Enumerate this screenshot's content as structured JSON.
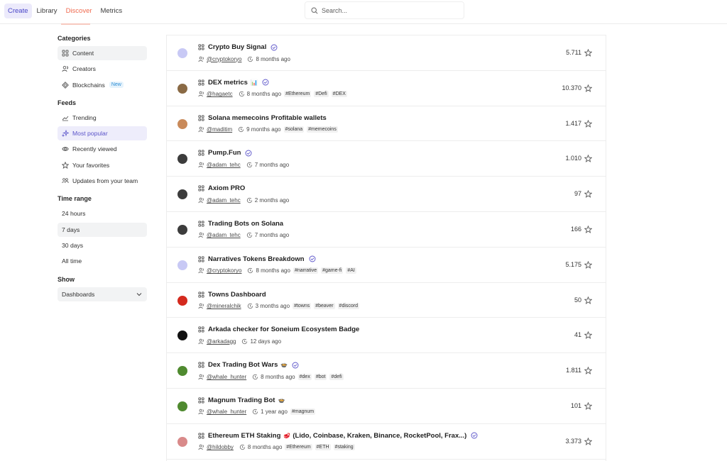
{
  "nav": {
    "tabs": [
      {
        "label": "Create"
      },
      {
        "label": "Library"
      },
      {
        "label": "Discover"
      },
      {
        "label": "Metrics"
      }
    ]
  },
  "search": {
    "placeholder": "Search..."
  },
  "sidebar": {
    "categories": {
      "heading": "Categories",
      "items": [
        {
          "label": "Content",
          "icon": "grid-icon"
        },
        {
          "label": "Creators",
          "icon": "users-icon"
        },
        {
          "label": "Blockchains",
          "icon": "diamond-icon",
          "badge": "New"
        }
      ]
    },
    "feeds": {
      "heading": "Feeds",
      "items": [
        {
          "label": "Trending",
          "icon": "trend-icon"
        },
        {
          "label": "Most popular",
          "icon": "sparkle-icon"
        },
        {
          "label": "Recently viewed",
          "icon": "eye-icon"
        },
        {
          "label": "Your favorites",
          "icon": "star-icon"
        },
        {
          "label": "Updates from your team",
          "icon": "team-icon"
        }
      ]
    },
    "time_range": {
      "heading": "Time range",
      "items": [
        {
          "label": "24 hours"
        },
        {
          "label": "7 days"
        },
        {
          "label": "30 days"
        },
        {
          "label": "All time"
        }
      ]
    },
    "show": {
      "heading": "Show",
      "selected": "Dashboards"
    }
  },
  "dashboards": [
    {
      "title": "Crypto Buy Signal",
      "emoji": "",
      "verified": true,
      "handle": "@cryptokoryo",
      "time": "8 months ago",
      "tags": [],
      "count": "5.711",
      "avatar_color": "#c8c9f5"
    },
    {
      "title": "DEX metrics",
      "emoji": "📊",
      "verified": true,
      "handle": "@hagaetc",
      "time": "8 months ago",
      "tags": [
        "#Ethereum",
        "#Defi",
        "#DEX"
      ],
      "count": "10.370",
      "avatar_color": "#8a6a45"
    },
    {
      "title": "Solana memecoins Profitable wallets",
      "emoji": "",
      "verified": false,
      "handle": "@maditim",
      "time": "9 months ago",
      "tags": [
        "#solana",
        "#memecoins"
      ],
      "count": "1.417",
      "avatar_color": "#c98a5a"
    },
    {
      "title": "Pump.Fun",
      "emoji": "",
      "verified": true,
      "handle": "@adam_tehc",
      "time": "7 months ago",
      "tags": [],
      "count": "1.010",
      "avatar_color": "#3c3c3c"
    },
    {
      "title": "Axiom PRO",
      "emoji": "",
      "verified": false,
      "handle": "@adam_tehc",
      "time": "2 months ago",
      "tags": [],
      "count": "97",
      "avatar_color": "#3c3c3c"
    },
    {
      "title": "Trading Bots on Solana",
      "emoji": "",
      "verified": false,
      "handle": "@adam_tehc",
      "time": "7 months ago",
      "tags": [],
      "count": "166",
      "avatar_color": "#3c3c3c"
    },
    {
      "title": "Narratives Tokens Breakdown",
      "emoji": "",
      "verified": true,
      "handle": "@cryptokoryo",
      "time": "8 months ago",
      "tags": [
        "#narrative",
        "#game-fi",
        "#AI"
      ],
      "count": "5.175",
      "avatar_color": "#c8c9f5"
    },
    {
      "title": "Towns Dashboard",
      "emoji": "",
      "verified": false,
      "handle": "@mineralchik",
      "time": "3 months ago",
      "tags": [
        "#towns",
        "#beaver",
        "#discord"
      ],
      "count": "50",
      "avatar_color": "#d42a1e"
    },
    {
      "title": "Arkada checker for Soneium Ecosystem Badge",
      "emoji": "",
      "verified": false,
      "handle": "@arkadagg",
      "time": "12 days ago",
      "tags": [],
      "count": "41",
      "avatar_color": "#111111"
    },
    {
      "title": "Dex Trading Bot Wars",
      "emoji": "🍲",
      "verified": true,
      "handle": "@whale_hunter",
      "time": "8 months ago",
      "tags": [
        "#dex",
        "#bot",
        "#defi"
      ],
      "count": "1.811",
      "avatar_color": "#4f8a2f"
    },
    {
      "title": "Magnum Trading Bot",
      "emoji": "🍲",
      "verified": false,
      "handle": "@whale_hunter",
      "time": "1 year ago",
      "tags": [
        "#magnum"
      ],
      "count": "101",
      "avatar_color": "#4f8a2f"
    },
    {
      "title": "Ethereum ETH Staking",
      "emoji": "🥩",
      "title_suffix": "(Lido, Coinbase, Kraken, Binance, RocketPool, Frax...)",
      "verified": true,
      "handle": "@hildobby",
      "time": "8 months ago",
      "tags": [
        "#Ethereum",
        "#ETH",
        "#staking"
      ],
      "count": "3.373",
      "avatar_color": "#d98a8a"
    }
  ]
}
